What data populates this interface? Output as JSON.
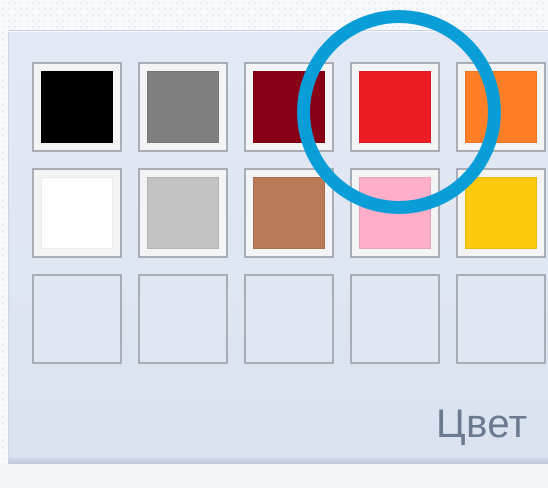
{
  "group": {
    "label": "Цвет"
  },
  "palette": {
    "rows": [
      [
        {
          "name": "black",
          "color": "#000000"
        },
        {
          "name": "gray",
          "color": "#7f7f7f"
        },
        {
          "name": "dark-red",
          "color": "#880015"
        },
        {
          "name": "red",
          "color": "#ed1c24"
        },
        {
          "name": "orange",
          "color": "#ff7f27"
        }
      ],
      [
        {
          "name": "white",
          "color": "#ffffff"
        },
        {
          "name": "light-gray",
          "color": "#c3c3c3"
        },
        {
          "name": "brown",
          "color": "#b97a57"
        },
        {
          "name": "rose",
          "color": "#ffaec9"
        },
        {
          "name": "gold",
          "color": "#ffc90e"
        }
      ],
      [
        {
          "name": "custom-1",
          "color": null
        },
        {
          "name": "custom-2",
          "color": null
        },
        {
          "name": "custom-3",
          "color": null
        },
        {
          "name": "custom-4",
          "color": null
        },
        {
          "name": "custom-5",
          "color": null
        }
      ]
    ]
  },
  "highlight": {
    "color": "#0a9ed8",
    "target": "red"
  }
}
